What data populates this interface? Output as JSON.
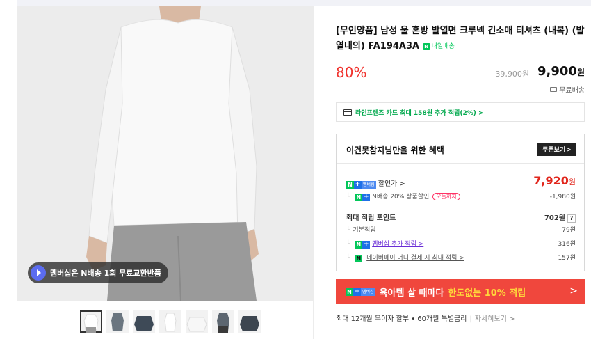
{
  "product": {
    "title": "[무인양품] 남성 울 혼방 발열면 크루넥 긴소매 티셔츠 (내복) (발열내의) FA194A3A",
    "delivery_badge": "내일배송",
    "discount": "80%",
    "original_price": "39,900원",
    "price_value": "9,900",
    "price_unit": "원",
    "shipping": "무료배송",
    "card_offer": "라인프렌즈 카드 최대 158원 추가 적립(2%) >"
  },
  "image": {
    "promo_label": "멤버십은 N배송 1회 무료교환반품",
    "thumbnail_count": 7,
    "active_thumbnail": 0
  },
  "benefit": {
    "title": "이건못참지님만을 위한 혜택",
    "coupon_button": "쿠폰보기 >",
    "membership_badge": "멤버십",
    "discount_label": "할인가 >",
    "discount_price_value": "7,920",
    "discount_price_unit": "원",
    "nship_label": "N배송 20% 상품할인",
    "nship_until": "오늘까지",
    "nship_value": "-1,980원",
    "points_label": "최대 적립 포인트",
    "points_value": "702원",
    "points_help": "?",
    "base_label": "기본적립",
    "base_value": "79원",
    "member_label": "멤버십 추가 적립 >",
    "member_value": "316원",
    "npay_label": "네이버페이 머니 결제 시 최대 적립 >",
    "npay_value": "157원"
  },
  "banner": {
    "badge": "멤버십",
    "text_white": "육아템 살 때마다",
    "text_highlight": "한도없는 10% 적립",
    "arrow": ">"
  },
  "installment": {
    "text": "최대 12개월 무이자 할부 • 60개월 특별금리",
    "sep": "|",
    "more": "자세히보기 >"
  },
  "colors": {
    "price_red": "#f0322d",
    "naver_green": "#03c75a",
    "banner_red": "#f0473d",
    "highlight_yellow": "#ffd83b"
  }
}
